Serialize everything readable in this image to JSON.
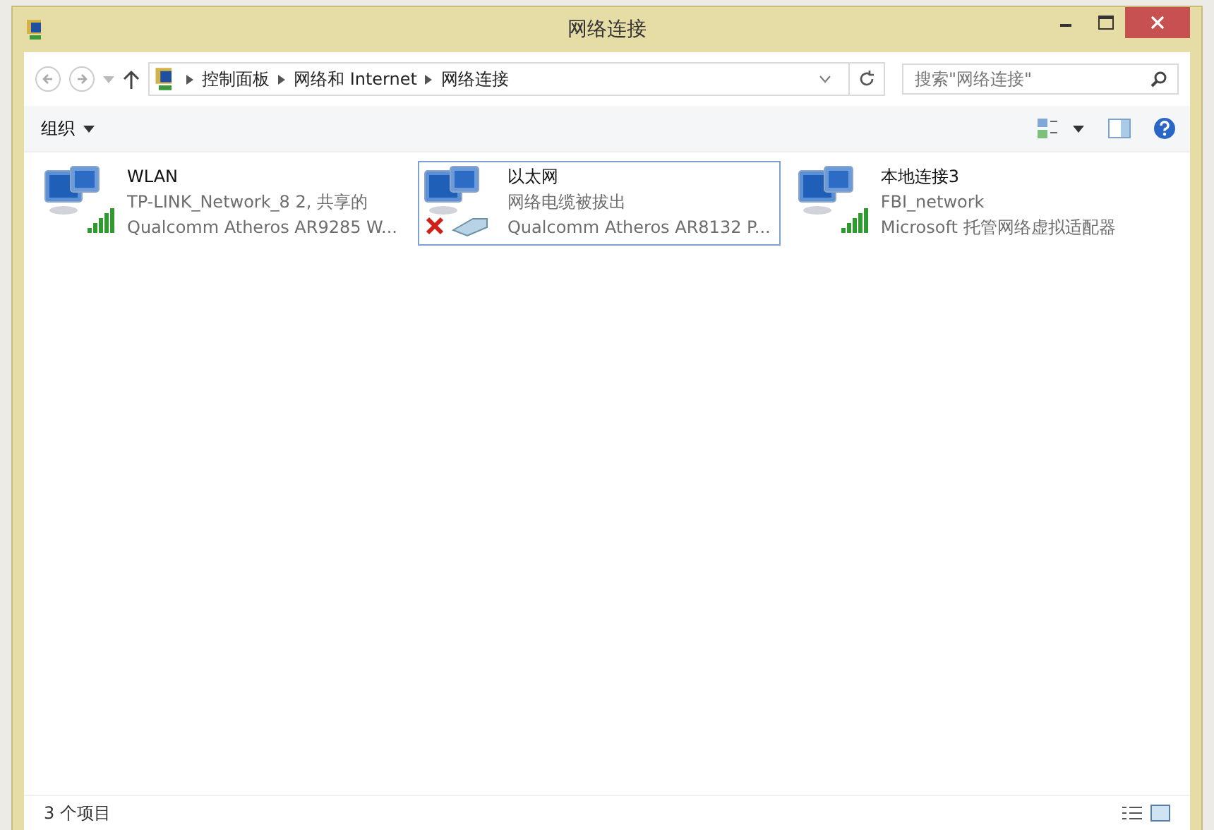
{
  "window": {
    "title": "网络连接"
  },
  "address": {
    "breadcrumbs": [
      "控制面板",
      "网络和 Internet",
      "网络连接"
    ]
  },
  "search": {
    "placeholder": "搜索\"网络连接\""
  },
  "toolbar": {
    "organize": "组织"
  },
  "connections": [
    {
      "name": "WLAN",
      "kind": "wireless",
      "line2": "TP-LINK_Network_8  2, 共享的",
      "line3": "Qualcomm Atheros AR9285 W...",
      "selected": false
    },
    {
      "name": "以太网",
      "kind": "unplugged",
      "line2": "网络电缆被拔出",
      "line3": "Qualcomm Atheros AR8132 P...",
      "selected": true
    },
    {
      "name": "本地连接3",
      "kind": "wireless",
      "line2": "FBI_network",
      "line3": "Microsoft 托管网络虚拟适配器",
      "selected": false
    }
  ],
  "status_bar": {
    "count": "3 个项目"
  }
}
